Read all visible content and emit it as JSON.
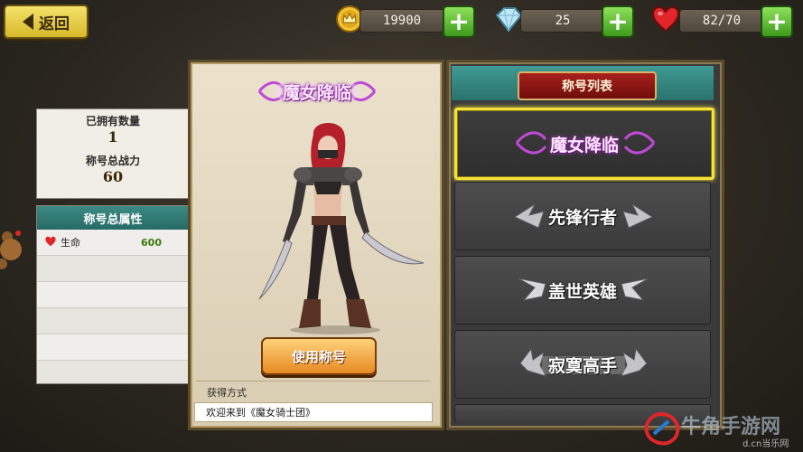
{
  "topbar": {
    "back_label": "返回",
    "gold": "19900",
    "gems": "25",
    "stamina": "82/70",
    "icons": [
      "crown-coin-icon",
      "diamond-icon",
      "heart-icon",
      "plus-icon"
    ],
    "colors": {
      "plus": "#3d9a1c",
      "back": "#d7b82a"
    }
  },
  "stats": {
    "owned_label": "已拥有数量",
    "owned_value": "1",
    "power_label": "称号总战力",
    "power_value": "60"
  },
  "attributes": {
    "header": "称号总属性",
    "rows": [
      {
        "icon": "heart-icon",
        "name": "生命",
        "value": "600"
      }
    ]
  },
  "character_card": {
    "title": "魔女降临",
    "use_button": "使用称号",
    "get_method_label": "获得方式",
    "get_method_desc": "欢迎来到《魔女骑士团》"
  },
  "title_list": {
    "header": "称号列表",
    "items": [
      {
        "label": "魔女降临",
        "selected": true,
        "style": "purple"
      },
      {
        "label": "先锋行者",
        "selected": false,
        "style": "silver-wings"
      },
      {
        "label": "盖世英雄",
        "selected": false,
        "style": "silver-wings"
      },
      {
        "label": "寂寞高手",
        "selected": false,
        "style": "silver-spikes"
      }
    ]
  },
  "watermark": {
    "brand": "牛角手游网",
    "url_hint": "d.cn当乐网"
  }
}
